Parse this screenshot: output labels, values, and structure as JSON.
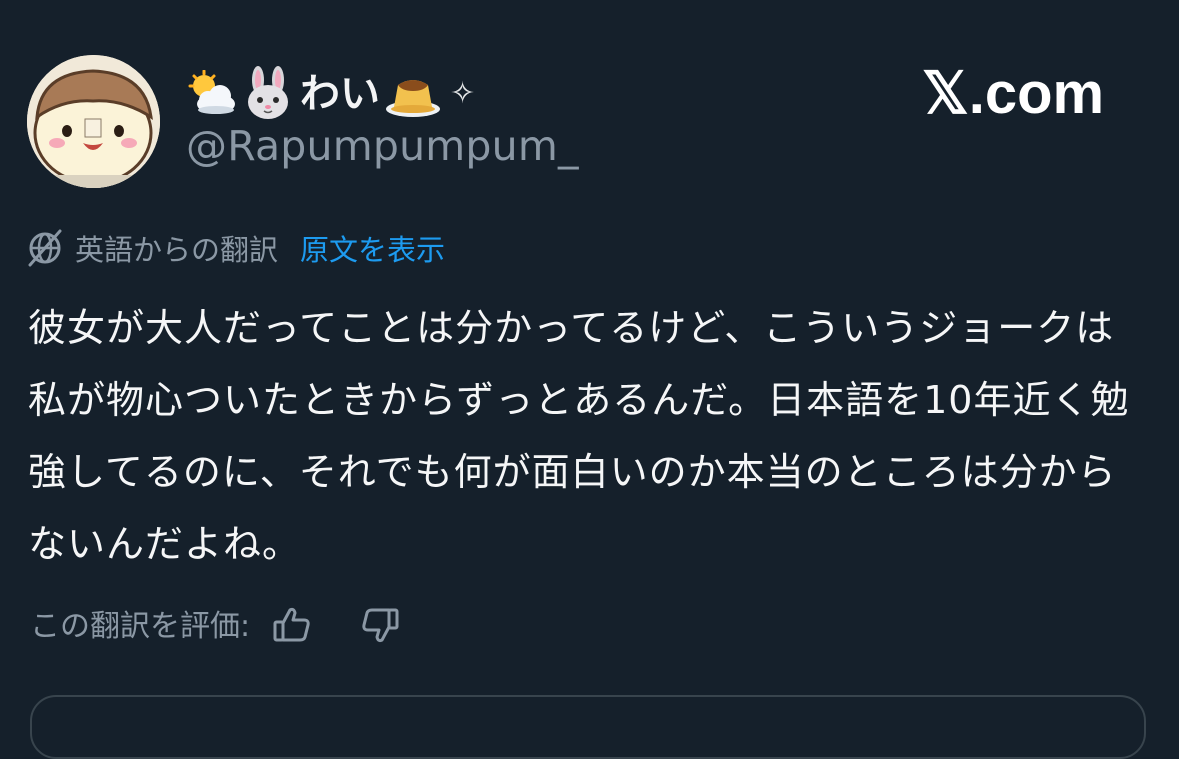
{
  "author": {
    "display_name": "わい",
    "handle": "@Rapumpumpum_",
    "emojis": [
      "sun-behind-cloud-icon",
      "rabbit-face-icon",
      "pudding-icon",
      "sparkle-icon"
    ],
    "sparkle": "✧"
  },
  "site_label": "𝕏.com",
  "translation": {
    "translated_from": "英語からの翻訳",
    "show_original": "原文を表示"
  },
  "tweet_text": "彼女が大人だってことは分かってるけど、こういうジョークは私が物心ついたときからずっとあるんだ。日本語を10年近く勉強してるのに、それでも何が面白いのか本当のところは分からないんだよね。",
  "rating": {
    "label": "この翻訳を評価:"
  },
  "colors": {
    "background": "#15202b",
    "text": "#e7e9ea",
    "muted": "#8b98a5",
    "link": "#1d9bf0"
  }
}
